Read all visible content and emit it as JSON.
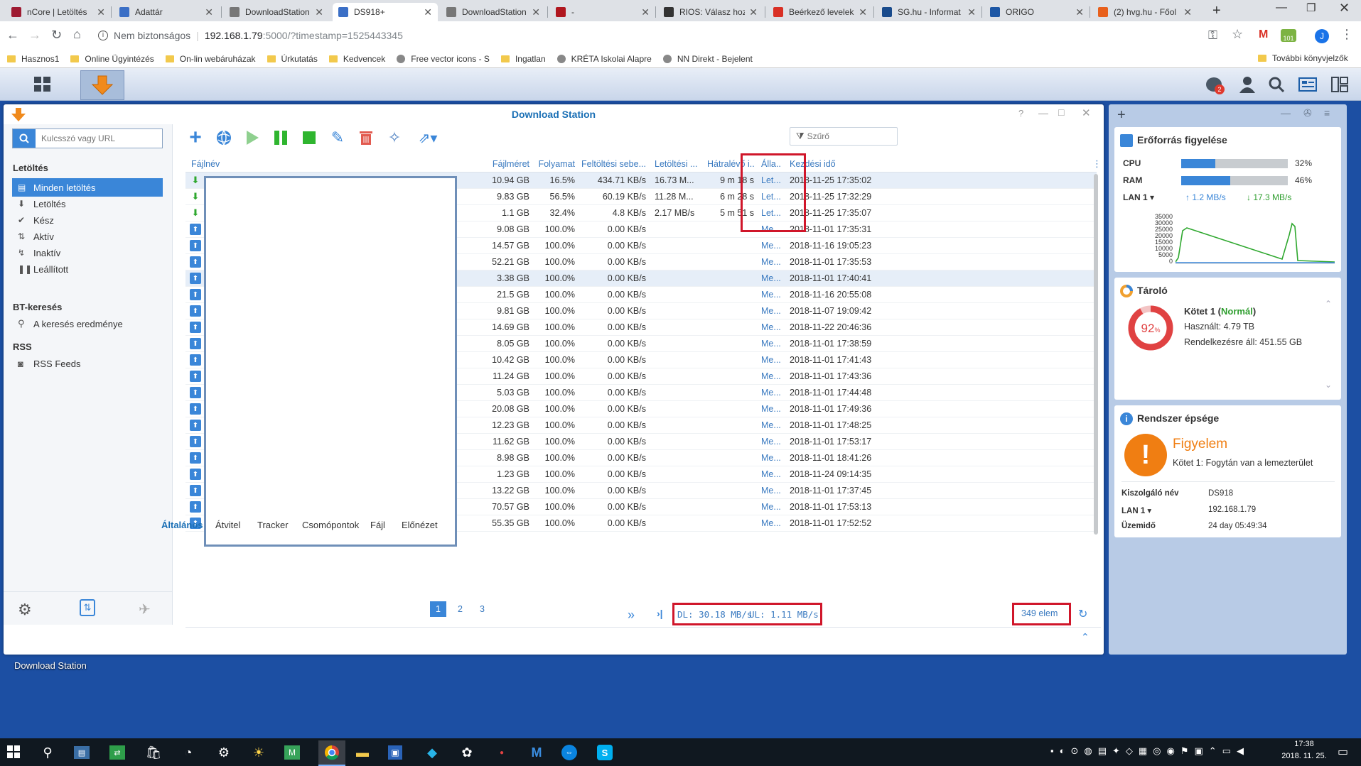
{
  "browser": {
    "tabs": [
      {
        "title": "nCore | Letöltés",
        "color": "#9e1b32"
      },
      {
        "title": "Adattár",
        "color": "#3b6fc6"
      },
      {
        "title": "DownloadStation",
        "color": "#777"
      },
      {
        "title": "DS918+",
        "color": "#3b6fc6",
        "active": true
      },
      {
        "title": "DownloadStation",
        "color": "#777"
      },
      {
        "title": "-",
        "color": "#b0171f"
      },
      {
        "title": "RIOS: Válasz hoz",
        "color": "#333"
      },
      {
        "title": "Beérkező levelek",
        "color": "#d93025"
      },
      {
        "title": "SG.hu - Informat",
        "color": "#1a4b8c"
      },
      {
        "title": "ORIGO",
        "color": "#1d57a5"
      },
      {
        "title": "(2) hvg.hu - Főol",
        "color": "#e8601c"
      }
    ],
    "new_tab": "+",
    "security": "Nem biztonságos",
    "url_host": "192.168.1.79",
    "url_rest": ":5000/?timestamp=1525443345",
    "profile_initial": "J",
    "ext_badge": "101",
    "bookmarks": [
      {
        "label": "Hasznos1",
        "type": "folder"
      },
      {
        "label": "Online Ügyintézés",
        "type": "folder"
      },
      {
        "label": "On-lin webáruházak",
        "type": "folder"
      },
      {
        "label": "Úrkutatás",
        "type": "folder"
      },
      {
        "label": "Kedvencek",
        "type": "folder"
      },
      {
        "label": "Free vector icons - S",
        "type": "site"
      },
      {
        "label": "Ingatlan",
        "type": "folder"
      },
      {
        "label": "KRÉTA Iskolai Alapre",
        "type": "site"
      },
      {
        "label": "NN Direkt - Bejelent",
        "type": "site"
      }
    ],
    "other_bookmarks": "További könyvjelzők"
  },
  "dsm": {
    "notif_count": "2"
  },
  "window": {
    "title": "Download Station",
    "search_placeholder": "Kulcsszó vagy URL",
    "filter_placeholder": "Szűrő",
    "sidebar": {
      "section1": "Letöltés",
      "items": [
        {
          "label": "Minden letöltés",
          "icon": "document-icon",
          "selected": true
        },
        {
          "label": "Letöltés",
          "icon": "arrow-down-icon"
        },
        {
          "label": "Kész",
          "icon": "check-icon"
        },
        {
          "label": "Aktív",
          "icon": "up-down-icon"
        },
        {
          "label": "Inaktív",
          "icon": "inactive-icon"
        },
        {
          "label": "Leállított",
          "icon": "pause-icon"
        }
      ],
      "section2": "BT-keresés",
      "search_result": "A keresés eredménye",
      "section3": "RSS",
      "rss": "RSS Feeds"
    },
    "columns": [
      "Fájlnév",
      "Fájlméret",
      "Folyamat",
      "Feltöltési sebe...",
      "Letöltési ...",
      "Hátralévő i...",
      "Álla...",
      "Kezdési idő"
    ],
    "rows": [
      {
        "dir": "down",
        "size": "10.94 GB",
        "progress": "16.5%",
        "ul": "434.71 KB/s",
        "dl": "16.73 M...",
        "eta": "9 m 18 s",
        "status": "Let...",
        "start": "2018-11-25 17:35:02",
        "hl": true
      },
      {
        "dir": "down",
        "size": "9.83 GB",
        "progress": "56.5%",
        "ul": "60.19 KB/s",
        "dl": "11.28 M...",
        "eta": "6 m 28 s",
        "status": "Let...",
        "start": "2018-11-25 17:32:29"
      },
      {
        "dir": "down",
        "size": "1.1 GB",
        "progress": "32.4%",
        "ul": "4.8 KB/s",
        "dl": "2.17 MB/s",
        "eta": "5 m 51 s",
        "status": "Let...",
        "start": "2018-11-25 17:35:07"
      },
      {
        "dir": "up",
        "size": "9.08 GB",
        "progress": "100.0%",
        "ul": "0.00 KB/s",
        "dl": "",
        "eta": "",
        "status": "Me...",
        "start": "2018-11-01 17:35:31"
      },
      {
        "dir": "up",
        "size": "14.57 GB",
        "progress": "100.0%",
        "ul": "0.00 KB/s",
        "dl": "",
        "eta": "",
        "status": "Me...",
        "start": "2018-11-16 19:05:23"
      },
      {
        "dir": "up",
        "size": "52.21 GB",
        "progress": "100.0%",
        "ul": "0.00 KB/s",
        "dl": "",
        "eta": "",
        "status": "Me...",
        "start": "2018-11-01 17:35:53"
      },
      {
        "dir": "up",
        "size": "3.38 GB",
        "progress": "100.0%",
        "ul": "0.00 KB/s",
        "dl": "",
        "eta": "",
        "status": "Me...",
        "start": "2018-11-01 17:40:41",
        "hl": true
      },
      {
        "dir": "up",
        "size": "21.5 GB",
        "progress": "100.0%",
        "ul": "0.00 KB/s",
        "dl": "",
        "eta": "",
        "status": "Me...",
        "start": "2018-11-16 20:55:08"
      },
      {
        "dir": "up",
        "size": "9.81 GB",
        "progress": "100.0%",
        "ul": "0.00 KB/s",
        "dl": "",
        "eta": "",
        "status": "Me...",
        "start": "2018-11-07 19:09:42"
      },
      {
        "dir": "up",
        "size": "14.69 GB",
        "progress": "100.0%",
        "ul": "0.00 KB/s",
        "dl": "",
        "eta": "",
        "status": "Me...",
        "start": "2018-11-22 20:46:36"
      },
      {
        "dir": "up",
        "size": "8.05 GB",
        "progress": "100.0%",
        "ul": "0.00 KB/s",
        "dl": "",
        "eta": "",
        "status": "Me...",
        "start": "2018-11-01 17:38:59"
      },
      {
        "dir": "up",
        "size": "10.42 GB",
        "progress": "100.0%",
        "ul": "0.00 KB/s",
        "dl": "",
        "eta": "",
        "status": "Me...",
        "start": "2018-11-01 17:41:43"
      },
      {
        "dir": "up",
        "size": "11.24 GB",
        "progress": "100.0%",
        "ul": "0.00 KB/s",
        "dl": "",
        "eta": "",
        "status": "Me...",
        "start": "2018-11-01 17:43:36"
      },
      {
        "dir": "up",
        "size": "5.03 GB",
        "progress": "100.0%",
        "ul": "0.00 KB/s",
        "dl": "",
        "eta": "",
        "status": "Me...",
        "start": "2018-11-01 17:44:48"
      },
      {
        "dir": "up",
        "size": "20.08 GB",
        "progress": "100.0%",
        "ul": "0.00 KB/s",
        "dl": "",
        "eta": "",
        "status": "Me...",
        "start": "2018-11-01 17:49:36"
      },
      {
        "dir": "up",
        "size": "12.23 GB",
        "progress": "100.0%",
        "ul": "0.00 KB/s",
        "dl": "",
        "eta": "",
        "status": "Me...",
        "start": "2018-11-01 17:48:25"
      },
      {
        "dir": "up",
        "size": "11.62 GB",
        "progress": "100.0%",
        "ul": "0.00 KB/s",
        "dl": "",
        "eta": "",
        "status": "Me...",
        "start": "2018-11-01 17:53:17"
      },
      {
        "dir": "up",
        "size": "8.98 GB",
        "progress": "100.0%",
        "ul": "0.00 KB/s",
        "dl": "",
        "eta": "",
        "status": "Me...",
        "start": "2018-11-01 18:41:26"
      },
      {
        "dir": "up",
        "size": "1.23 GB",
        "progress": "100.0%",
        "ul": "0.00 KB/s",
        "dl": "",
        "eta": "",
        "status": "Me...",
        "start": "2018-11-24 09:14:35"
      },
      {
        "dir": "up",
        "size": "13.22 GB",
        "progress": "100.0%",
        "ul": "0.00 KB/s",
        "dl": "",
        "eta": "",
        "status": "Me...",
        "start": "2018-11-01 17:37:45"
      },
      {
        "dir": "up",
        "size": "70.57 GB",
        "progress": "100.0%",
        "ul": "0.00 KB/s",
        "dl": "",
        "eta": "",
        "status": "Me...",
        "start": "2018-11-01 17:53:13"
      },
      {
        "dir": "up",
        "size": "55.35 GB",
        "progress": "100.0%",
        "ul": "0.00 KB/s",
        "dl": "",
        "eta": "",
        "status": "Me...",
        "start": "2018-11-01 17:52:52"
      }
    ],
    "pages": [
      "1",
      "2",
      "3"
    ],
    "current_page": "1",
    "dl_total": "DL: 30.18 MB/s",
    "ul_total": "UL: 1.11 MB/s",
    "item_count": "349 elem",
    "bottom_tabs": [
      "Általános",
      "Átvitel",
      "Tracker",
      "Csomópontok",
      "Fájl",
      "Előnézet"
    ]
  },
  "widgets": {
    "resource": {
      "title": "Erőforrás figyelése",
      "cpu_label": "CPU",
      "cpu_value": "32%",
      "cpu": 0.32,
      "ram_label": "RAM",
      "ram_value": "46%",
      "ram": 0.46,
      "lan_label": "LAN 1",
      "lan_up": "1.2 MB/s",
      "lan_down": "17.3 MB/s",
      "y_ticks": [
        "35000",
        "30000",
        "25000",
        "20000",
        "15000",
        "10000",
        "5000",
        "0"
      ]
    },
    "storage": {
      "title": "Tároló",
      "percent": "92",
      "percent_sign": "%",
      "volume": "Kötet 1",
      "volume_status": "Normál",
      "used": "Használt: 4.79 TB",
      "available": "Rendelkezésre áll: 451.55 GB"
    },
    "health": {
      "title": "Rendszer épsége",
      "status": "Figyelem",
      "message": "Kötet 1: Fogytán van a lemezterület",
      "server_label": "Kiszolgáló név",
      "server_value": "DS918",
      "lan_label": "LAN 1",
      "lan_value": "192.168.1.79",
      "uptime_label": "Üzemidő",
      "uptime_value": "24 day 05:49:34"
    }
  },
  "desktop_label": "Download Station",
  "clock": {
    "time": "17:38",
    "date": "2018. 11. 25."
  }
}
